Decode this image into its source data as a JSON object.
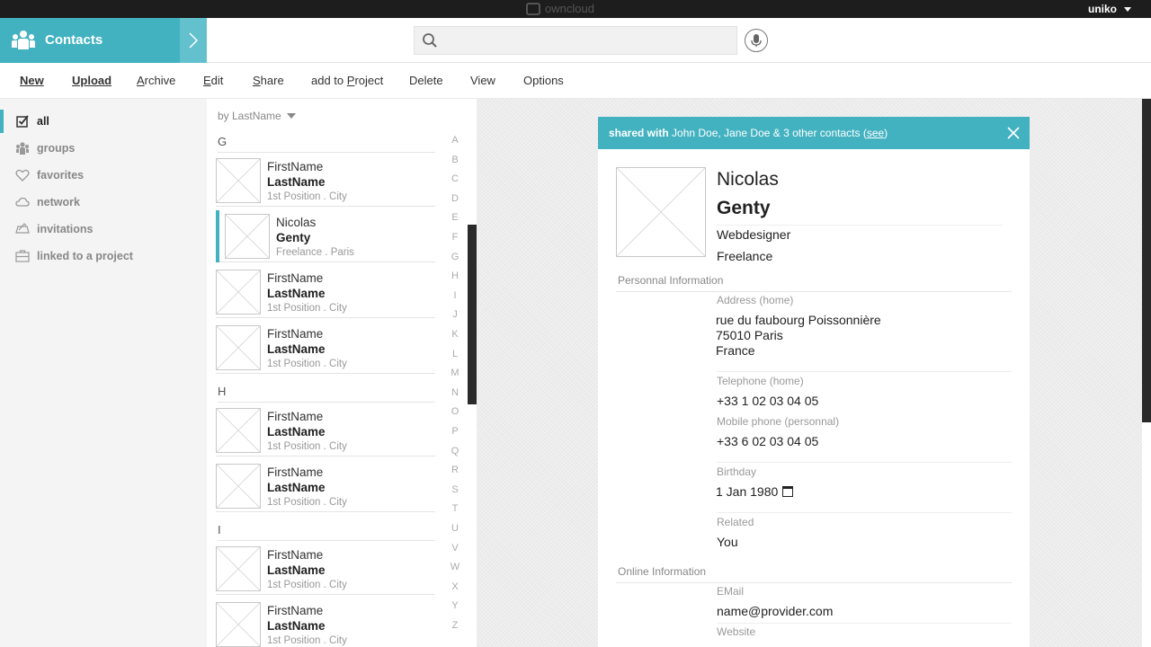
{
  "topbar": {
    "brand": "owncloud",
    "user": "uniko"
  },
  "app": {
    "title": "Contacts"
  },
  "search": {
    "placeholder": ""
  },
  "toolbar": {
    "new": "New",
    "upload": "Upload",
    "archive_a": "A",
    "archive_b": "rchive",
    "edit_a": "E",
    "edit_b": "dit",
    "share_a": "S",
    "share_b": "hare",
    "project_a": "add to ",
    "project_b": "P",
    "project_c": "roject",
    "delete": "Delete",
    "view": "View",
    "options": "Options"
  },
  "sidebar": {
    "items": [
      {
        "label": "all",
        "icon": "checkbox-icon"
      },
      {
        "label": "groups",
        "icon": "group-icon"
      },
      {
        "label": "favorites",
        "icon": "heart-icon"
      },
      {
        "label": "network",
        "icon": "cloud-icon"
      },
      {
        "label": "invitations",
        "icon": "invitation-icon"
      },
      {
        "label": "linked to a project",
        "icon": "briefcase-icon"
      }
    ]
  },
  "list": {
    "sort_label": "by LastName",
    "letters": [
      "G",
      "H",
      "I"
    ],
    "contacts": [
      {
        "first": "FirstName",
        "last": "LastName",
        "meta": "1st Position . City"
      },
      {
        "first": "Nicolas",
        "last": "Genty",
        "meta": "Freelance . Paris"
      },
      {
        "first": "FirstName",
        "last": "LastName",
        "meta": "1st Position . City"
      },
      {
        "first": "FirstName",
        "last": "LastName",
        "meta": "1st Position . City"
      },
      {
        "first": "FirstName",
        "last": "LastName",
        "meta": "1st Position . City"
      },
      {
        "first": "FirstName",
        "last": "LastName",
        "meta": "1st Position . City"
      },
      {
        "first": "FirstName",
        "last": "LastName",
        "meta": "1st Position . City"
      },
      {
        "first": "FirstName",
        "last": "LastName",
        "meta": "1st Position . City"
      }
    ],
    "alphabet": [
      "A",
      "B",
      "C",
      "D",
      "E",
      "F",
      "G",
      "H",
      "I",
      "J",
      "K",
      "L",
      "M",
      "N",
      "O",
      "P",
      "Q",
      "R",
      "S",
      "T",
      "U",
      "V",
      "W",
      "X",
      "Y",
      "Z"
    ]
  },
  "detail": {
    "shared_prefix": "shared with",
    "shared_names": " John Doe, Jane Doe & 3 other contacts (",
    "shared_see": "see",
    "shared_suffix": ")",
    "first_name": "Nicolas",
    "last_name": "Genty",
    "position": "Webdesigner",
    "company": "Freelance",
    "section_personal": "Personnal Information",
    "address_label": "Address (home)",
    "address_line1": "rue du faubourg Poissonnière",
    "address_line2": "75010 Paris",
    "address_line3": "France",
    "tel_home_label": "Telephone (home)",
    "tel_home": "+33 1 02 03 04 05",
    "mobile_label": "Mobile phone (personnal)",
    "mobile": "+33 6 02 03 04 05",
    "birthday_label": "Birthday",
    "birthday": "1 Jan 1980",
    "related_label": "Related",
    "related": "You",
    "section_online": "Online Information",
    "email_label": "EMail",
    "email": "name@provider.com",
    "website_label": "Website"
  },
  "colors": {
    "accent": "#43b2c0",
    "topbar": "#1d1d1d",
    "sidebar": "#f4f4f4"
  }
}
